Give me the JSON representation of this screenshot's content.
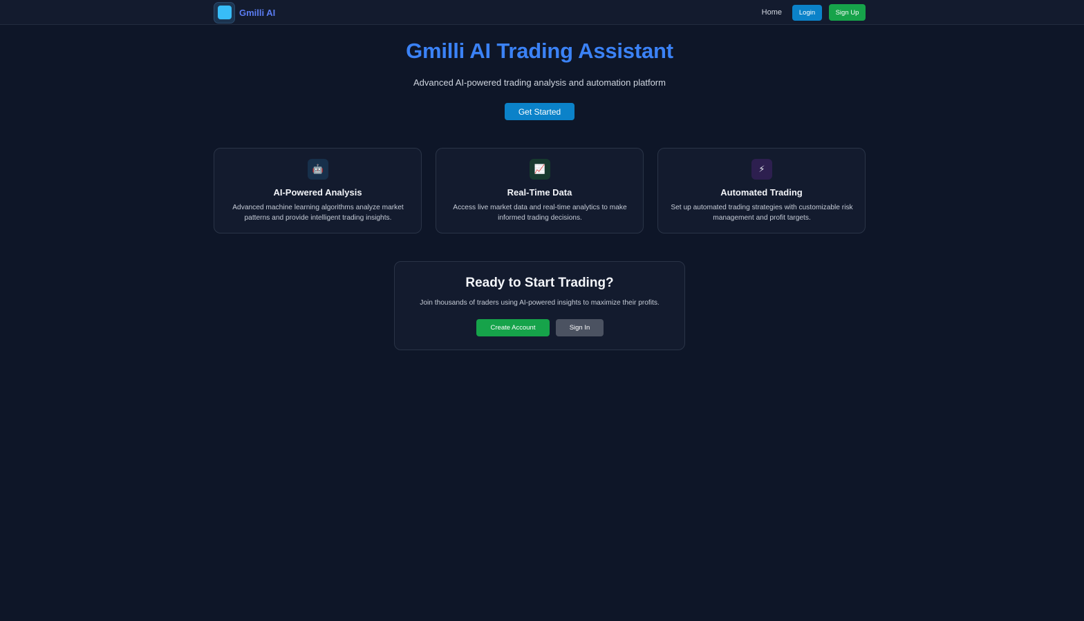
{
  "nav": {
    "brand": "Gmilli AI",
    "home": "Home",
    "login": "Login",
    "signup": "Sign Up"
  },
  "hero": {
    "title": "Gmilli AI Trading Assistant",
    "subtitle": "Advanced AI-powered trading analysis and automation platform",
    "cta": "Get Started"
  },
  "features": [
    {
      "icon": "🤖",
      "icon_name": "robot-icon",
      "title": "AI-Powered Analysis",
      "description": "Advanced machine learning algorithms analyze market patterns and provide intelligent trading insights."
    },
    {
      "icon": "📈",
      "icon_name": "chart-increasing-icon",
      "title": "Real-Time Data",
      "description": "Access live market data and real-time analytics to make informed trading decisions."
    },
    {
      "icon": "⚡",
      "icon_name": "lightning-icon",
      "title": "Automated Trading",
      "description": "Set up automated trading strategies with customizable risk management and profit targets."
    }
  ],
  "cta_section": {
    "title": "Ready to Start Trading?",
    "description": "Join thousands of traders using AI-powered insights to maximize their profits.",
    "create_account": "Create Account",
    "sign_in": "Sign In"
  },
  "colors": {
    "background": "#0e1628",
    "primary": "#0b82c9",
    "success": "#16a34a",
    "title_blue": "#3b82f6"
  }
}
